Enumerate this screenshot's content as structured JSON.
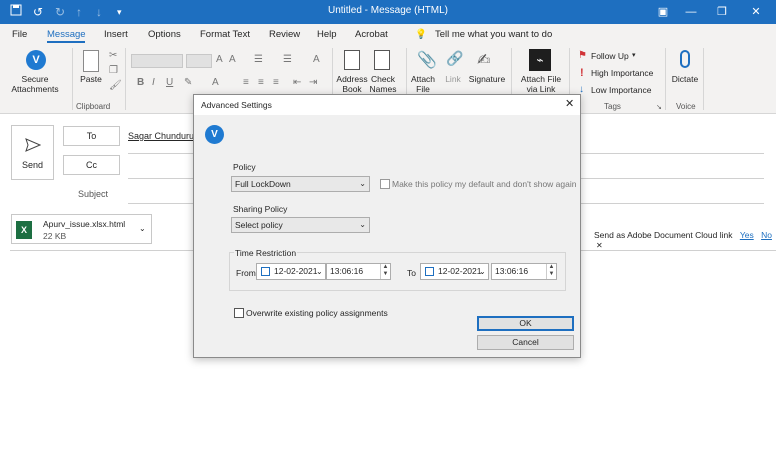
{
  "window": {
    "title": "Untitled  -  Message (HTML)"
  },
  "menu": {
    "items": [
      "File",
      "Message",
      "Insert",
      "Options",
      "Format Text",
      "Review",
      "Help",
      "Acrobat"
    ],
    "tell_me": "Tell me what you want to do",
    "active": "Message"
  },
  "ribbon": {
    "secure_attachments": "Secure\nAttachments",
    "paste": "Paste",
    "clipboard": "Clipboard",
    "address_book": "Address\nBook",
    "check_names": "Check\nNames",
    "attach_file": "Attach\nFile",
    "link": "Link",
    "signature": "Signature",
    "attach_file_via_link": "Attach File\nvia Link",
    "follow_up": "Follow Up",
    "high_importance": "High Importance",
    "low_importance": "Low Importance",
    "tags": "Tags",
    "dictate": "Dictate",
    "voice": "Voice"
  },
  "compose": {
    "send": "Send",
    "to": "To",
    "cc": "Cc",
    "subject": "Subject",
    "to_value": "Sagar Chunduru",
    "attachment": {
      "name": "Apurv_issue.xlsx.html",
      "size": "22 KB"
    },
    "cloud_prompt": "Send as Adobe Document Cloud link",
    "cloud_yes": "Yes",
    "cloud_no": "No"
  },
  "dialog": {
    "title": "Advanced Settings",
    "policy_label": "Policy",
    "policy_value": "Full LockDown",
    "default_checkbox": "Make this policy my default and don't show again",
    "sharing_label": "Sharing Policy",
    "sharing_value": "Select policy",
    "time_restriction": "Time Restriction",
    "from_label": "From",
    "to_label": "To",
    "from_date": "12-02-2021",
    "from_time": "13:06:16",
    "to_date": "12-02-2021",
    "to_time": "13:06:16",
    "overwrite": "Overwrite existing policy assignments",
    "ok": "OK",
    "cancel": "Cancel"
  },
  "colors": {
    "accent": "#1e6fc0",
    "brand_v": "#1f7ad1",
    "adobe": "#1e1e1e",
    "excel": "#1d6f42"
  }
}
